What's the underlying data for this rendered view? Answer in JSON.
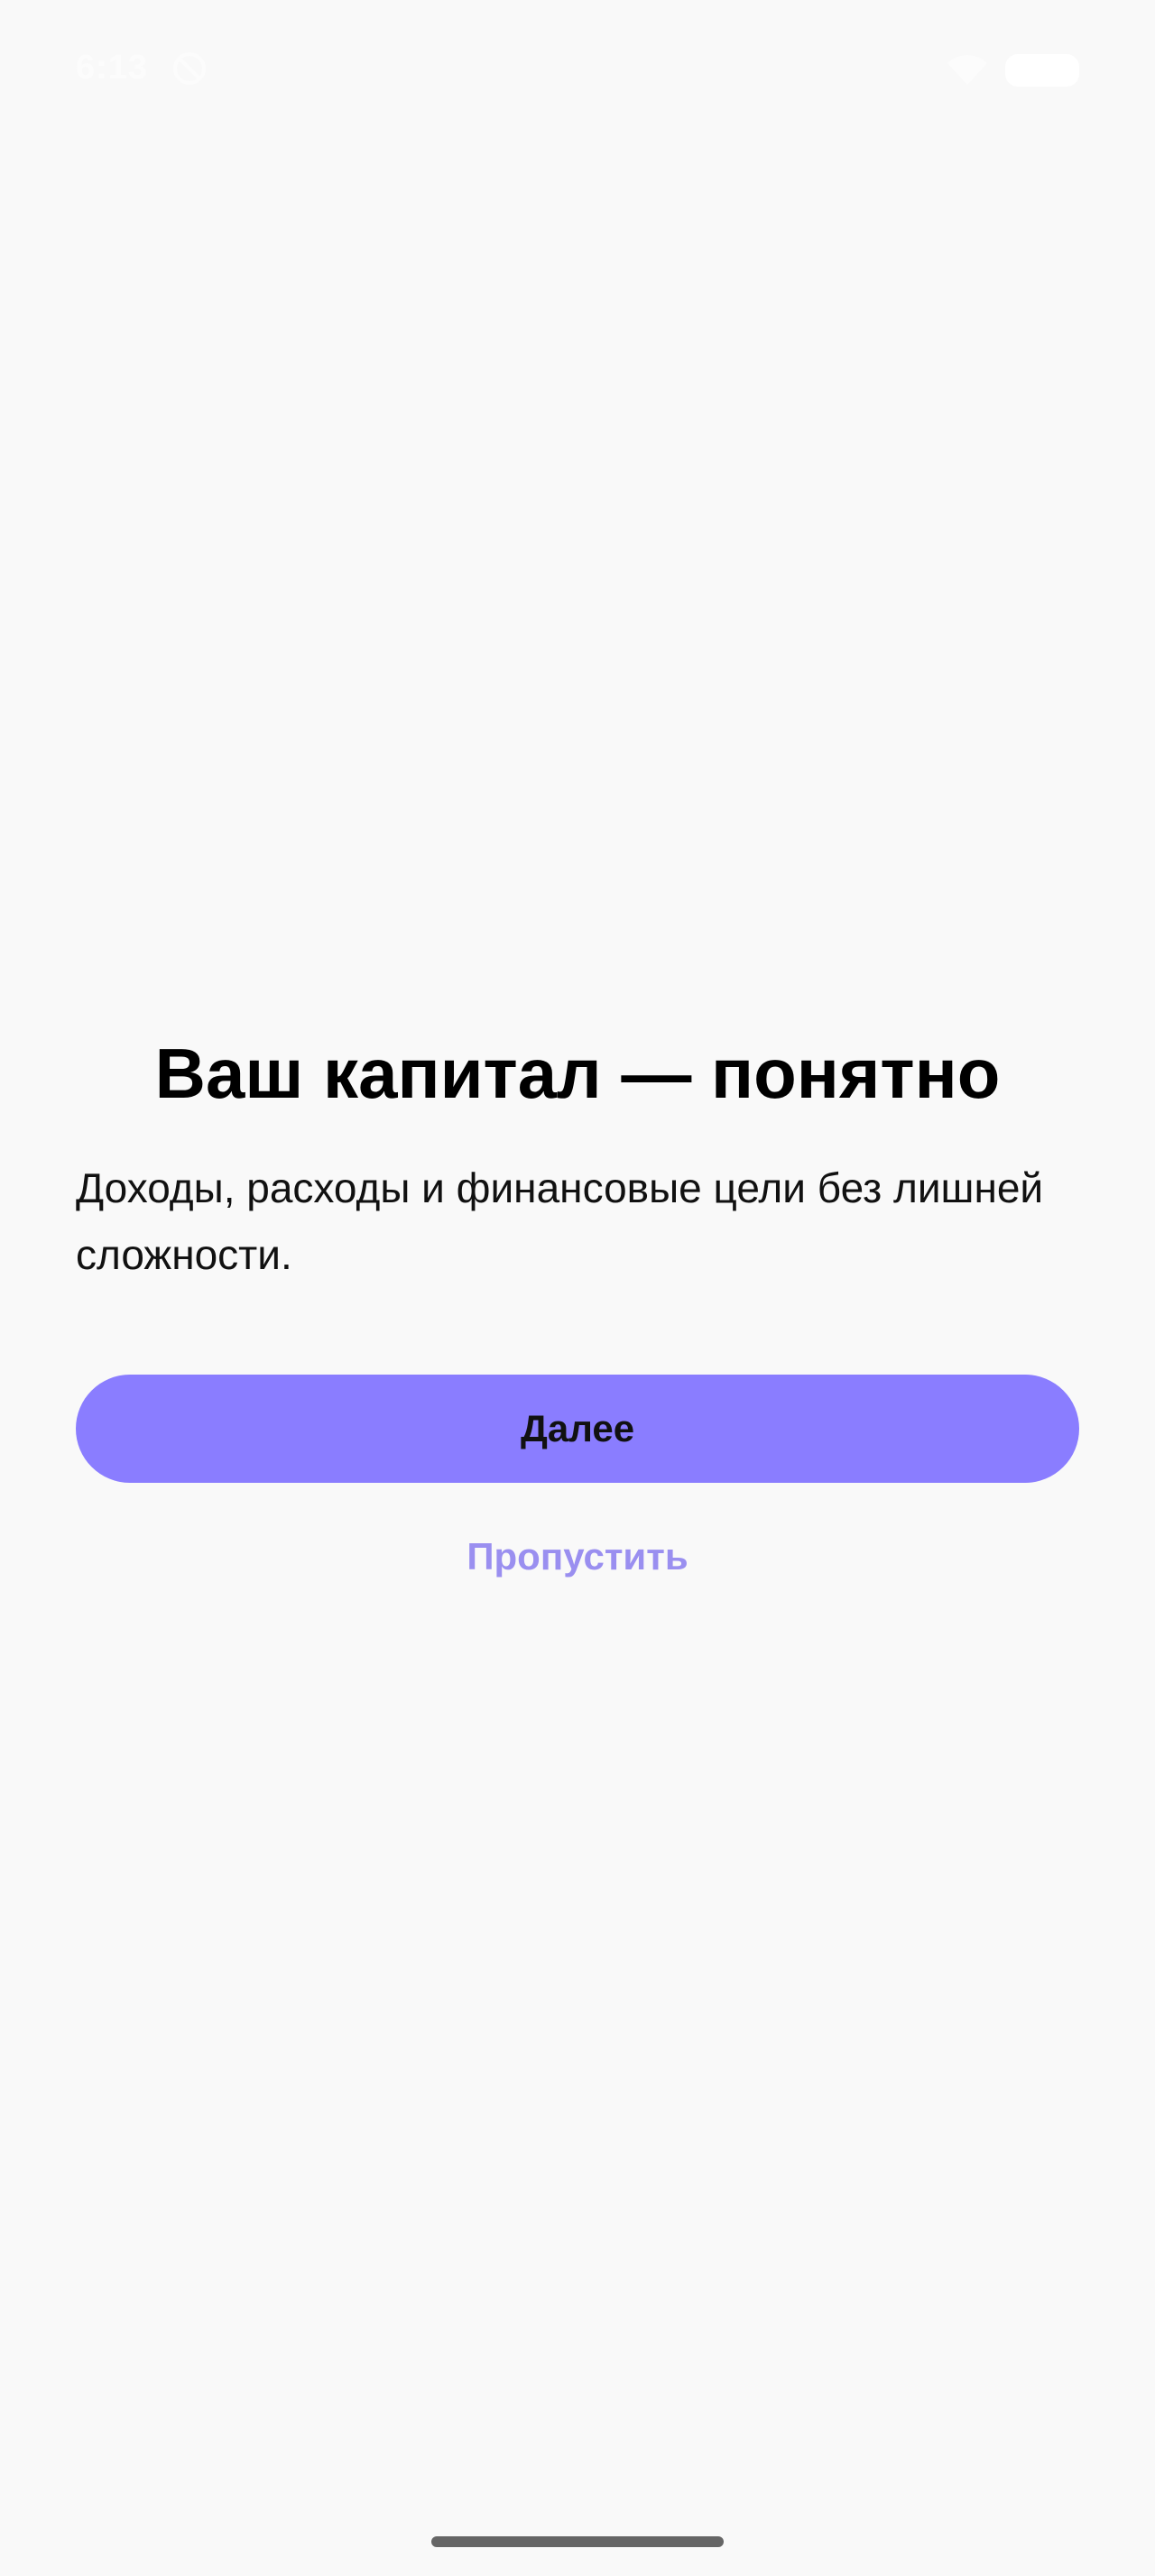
{
  "status_bar": {
    "time": "6:13",
    "icons": [
      "do-not-disturb-icon",
      "wifi-icon",
      "battery-icon"
    ]
  },
  "onboarding": {
    "title": "Ваш капитал — понятно",
    "subtitle": "Доходы, расходы и финансовые цели без лишней сложности.",
    "next_label": "Далее",
    "skip_label": "Пропустить"
  },
  "colors": {
    "background": "#f9f9f9",
    "primary_button": "#8a7dff",
    "skip_link": "#9a8ff0"
  }
}
